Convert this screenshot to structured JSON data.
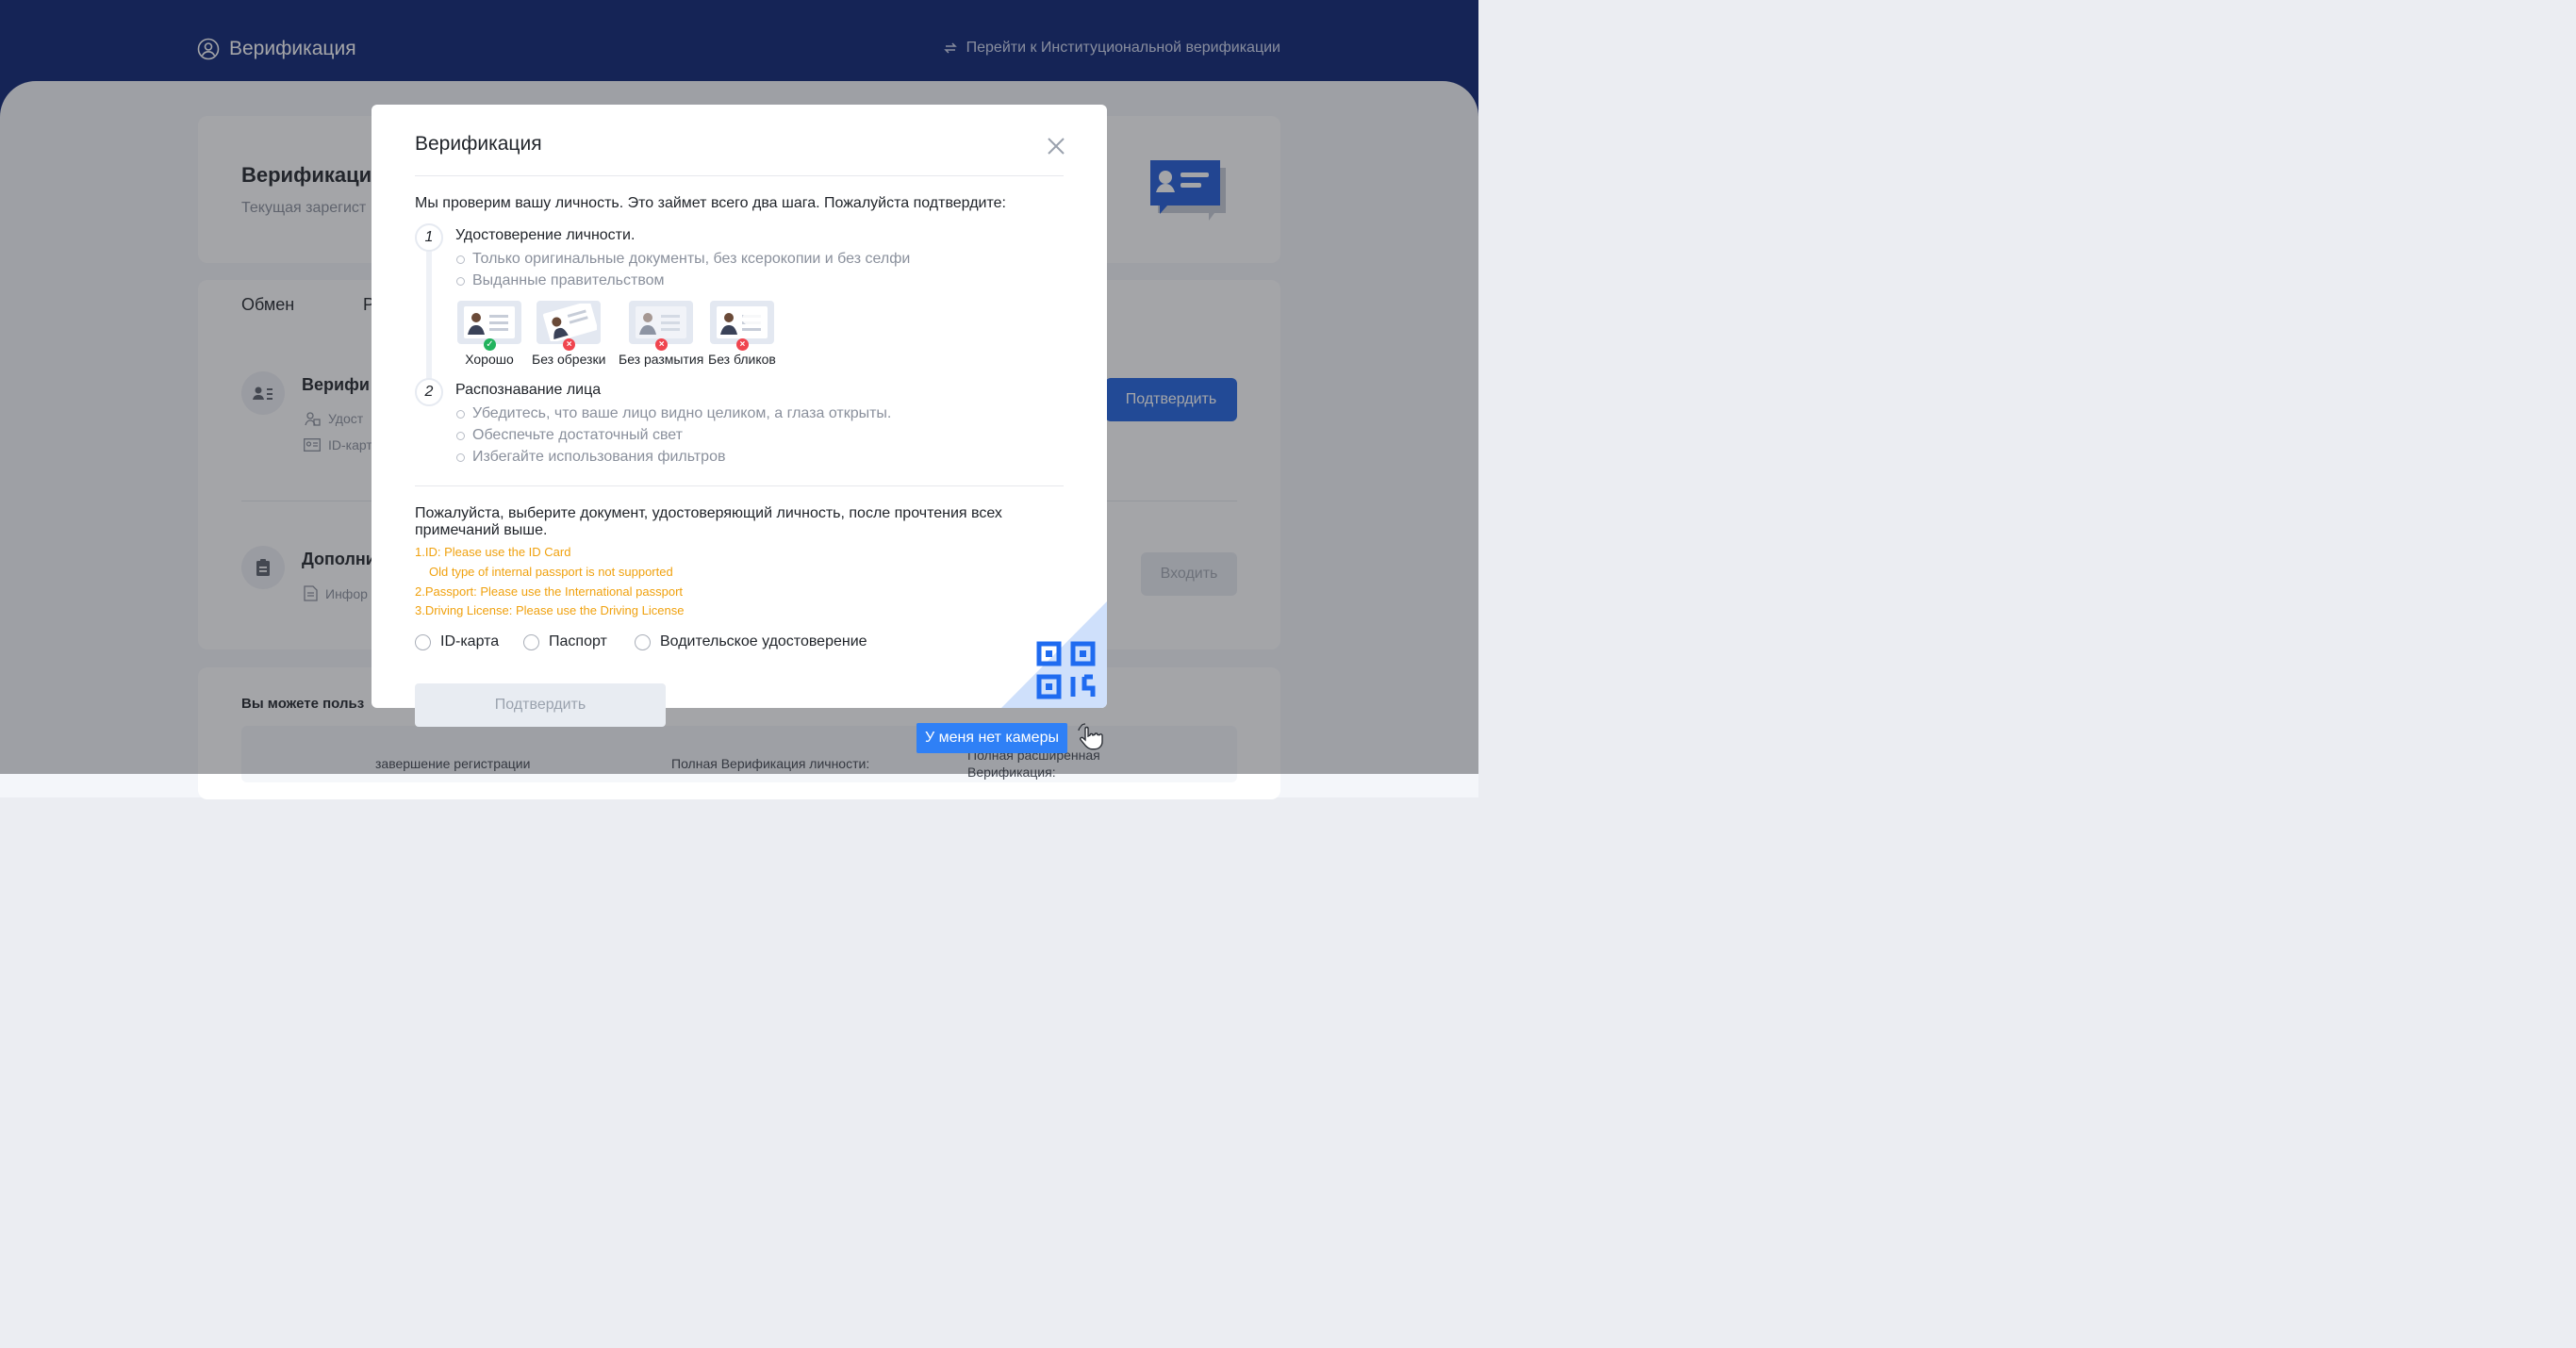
{
  "header": {
    "title": "Верификация",
    "switch_link": "Перейти к Институциональной верификации"
  },
  "background": {
    "hero_title": "Верификаци",
    "hero_subtitle": "Текущая зарегист",
    "tabs": [
      "Обмен",
      "Р"
    ],
    "rows": [
      {
        "title": "Верифи",
        "lines": [
          "Удост",
          "ID-карт"
        ],
        "button": "Подтвердить"
      },
      {
        "title": "Дополни",
        "lines": [
          "Инфор"
        ],
        "button": "Входить"
      }
    ],
    "bottom_text": "Вы можете польз",
    "bottom_cols": [
      "завершение регистрации",
      "Полная Верификация личности:",
      "Полная расширенная Верификация:"
    ]
  },
  "modal": {
    "title": "Верификация",
    "intro": "Мы проверим вашу личность. Это займет всего два шага. Пожалуйста подтвердите:",
    "steps": [
      {
        "num": "1",
        "title": "Удостоверение личности.",
        "bullets": [
          "Только оригинальные документы, без ксерокопии и без селфи",
          "Выданные правительством"
        ]
      },
      {
        "num": "2",
        "title": "Распознавание лица",
        "bullets": [
          "Убедитесь, что ваше лицо видно целиком, а глаза открыты.",
          "Обеспечьте достаточный свет",
          "Избегайте использования фильтров"
        ]
      }
    ],
    "samples": [
      {
        "label": "Хорошо",
        "ok": true
      },
      {
        "label": "Без обрезки",
        "ok": false
      },
      {
        "label": "Без размытия",
        "ok": false
      },
      {
        "label": "Без бликов",
        "ok": false
      }
    ],
    "choose_text": "Пожалуйста, выберите документ, удостоверяющий личность, после прочтения всех примечаний выше.",
    "notes": [
      "1.ID: Please use the ID Card",
      "Old type of internal passport is not supported",
      "2.Passport: Please use the International passport",
      "3.Driving License: Please use the Driving License"
    ],
    "doc_types": [
      "ID-карта",
      "Паспорт",
      "Водительское удостоверение"
    ],
    "confirm": "Подтвердить",
    "no_camera": "У меня нет камеры"
  },
  "colors": {
    "header_bg": "#0a2272",
    "accent": "#2f80f6",
    "warning_text": "#f0a10e",
    "ok": "#22b35e",
    "error": "#f0454f"
  }
}
